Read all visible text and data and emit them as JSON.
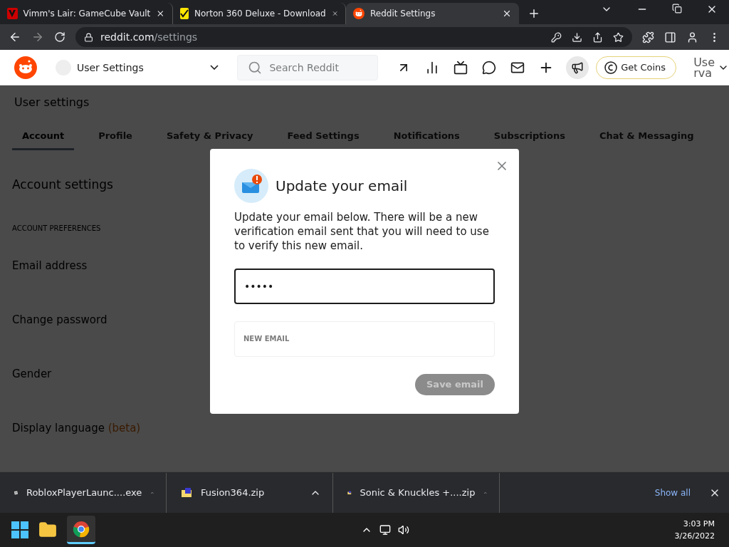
{
  "browser": {
    "tabs": [
      {
        "title": "Vimm's Lair: GameCube Vault",
        "selected": false
      },
      {
        "title": "Norton 360 Deluxe - Download",
        "selected": false
      },
      {
        "title": "Reddit Settings",
        "selected": true
      }
    ],
    "url": {
      "host": "reddit.com",
      "path": "/settings"
    }
  },
  "header": {
    "location": "User Settings",
    "search_placeholder": "Search Reddit",
    "coins_button": "Get Coins",
    "user_lines": [
      "Use",
      "rva"
    ]
  },
  "page": {
    "title": "User settings",
    "tabs": [
      {
        "label": "Account",
        "selected": true
      },
      {
        "label": "Profile",
        "selected": false
      },
      {
        "label": "Safety & Privacy",
        "selected": false
      },
      {
        "label": "Feed Settings",
        "selected": false
      },
      {
        "label": "Notifications",
        "selected": false
      },
      {
        "label": "Subscriptions",
        "selected": false
      },
      {
        "label": "Chat & Messaging",
        "selected": false
      }
    ],
    "section_title": "Account settings",
    "group_label": "ACCOUNT PREFERENCES",
    "settings": [
      {
        "title": "Email address"
      },
      {
        "title": "Change password"
      },
      {
        "title": "Gender"
      },
      {
        "title": "Display language",
        "badge": "(beta)"
      }
    ]
  },
  "modal": {
    "title": "Update your email",
    "body": "Update your email below. There will be a new verification email sent that you will need to use to verify this new email.",
    "password_value": "•••••",
    "new_email_placeholder": "NEW EMAIL",
    "save_button": {
      "label": "Save email",
      "disabled": true
    }
  },
  "downloads": {
    "items": [
      {
        "name": "RobloxPlayerLaunc....exe",
        "kind": "exe"
      },
      {
        "name": "Fusion364.zip",
        "kind": "zip"
      },
      {
        "name": "Sonic & Knuckles +....zip",
        "kind": "zip"
      }
    ],
    "show_all": "Show all"
  },
  "taskbar": {
    "time": "3:03 PM",
    "date": "3/26/2022"
  }
}
